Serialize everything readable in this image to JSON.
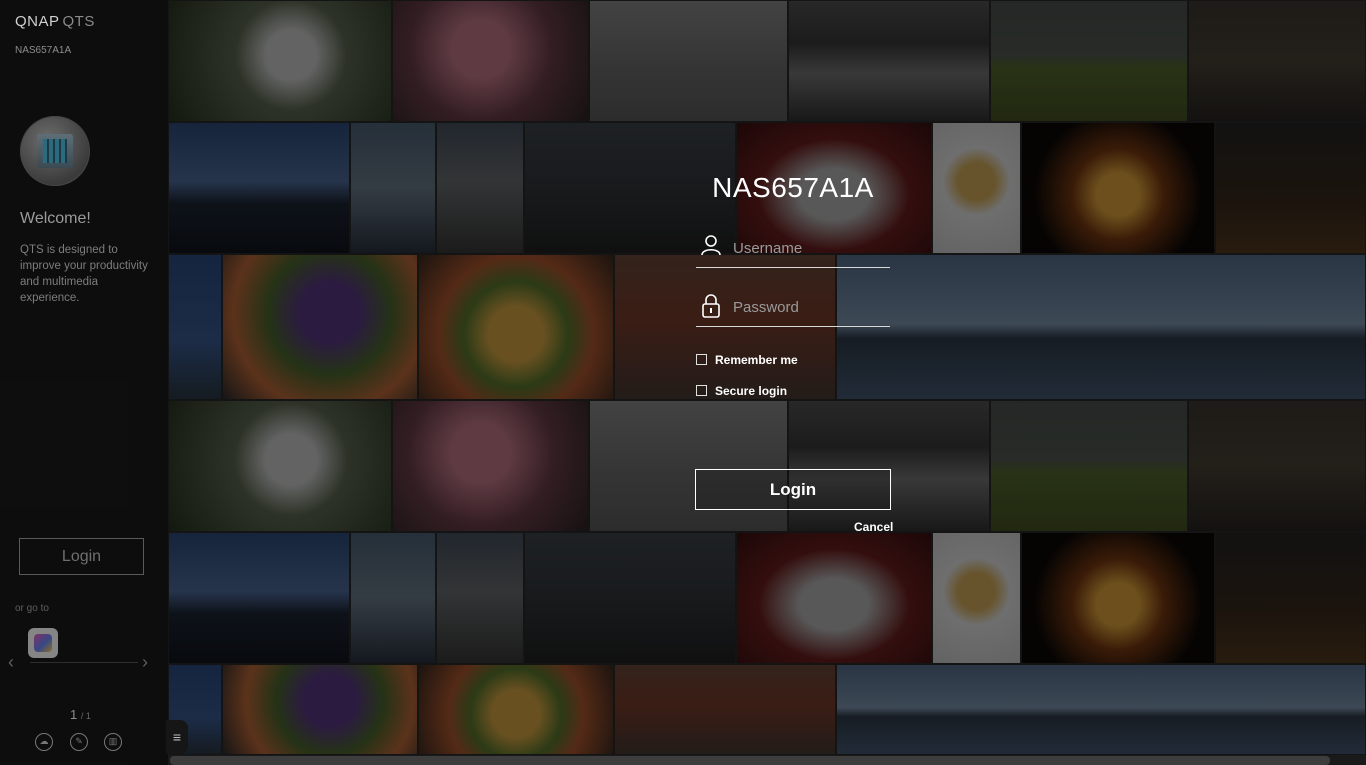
{
  "brand": {
    "name": "QNAP",
    "product": "QTS"
  },
  "side_panel": {
    "hostname": "NAS657A1A",
    "welcome": "Welcome!",
    "intro": "QTS is designed to improve your productivity and multimedia experience.",
    "login_label": "Login",
    "go_to_label": "or go to",
    "app_icon": "qfinder-app-icon",
    "prev_icon": "chevron-left-icon",
    "next_icon": "chevron-right-icon",
    "page_current": "1",
    "page_total": "/ 1",
    "bottom_icons": [
      "cloud-icon",
      "tools-icon",
      "app-grid-icon"
    ],
    "menu_icon": "hamburger-icon"
  },
  "login_form": {
    "device_name": "NAS657A1A",
    "username_placeholder": "Username",
    "password_placeholder": "Password",
    "remember_me": "Remember me",
    "secure_login": "Secure login",
    "login_button": "Login",
    "cancel": "Cancel",
    "user_icon": "user-icon",
    "lock_icon": "lock-icon"
  },
  "photo_wall": {
    "subjects": [
      "flower",
      "pink-blossom",
      "lake",
      "sea",
      "tractor",
      "street",
      "villa",
      "boat",
      "pier",
      "canal",
      "race-car",
      "ice-cream",
      "carousel",
      "rainy-street",
      "sky",
      "food",
      "food",
      "brick-warehouse",
      "coast"
    ]
  },
  "colors": {
    "background": "#111111",
    "panel": "#0e0e0e",
    "text": "#ffffff",
    "muted": "#8d8d8d"
  }
}
